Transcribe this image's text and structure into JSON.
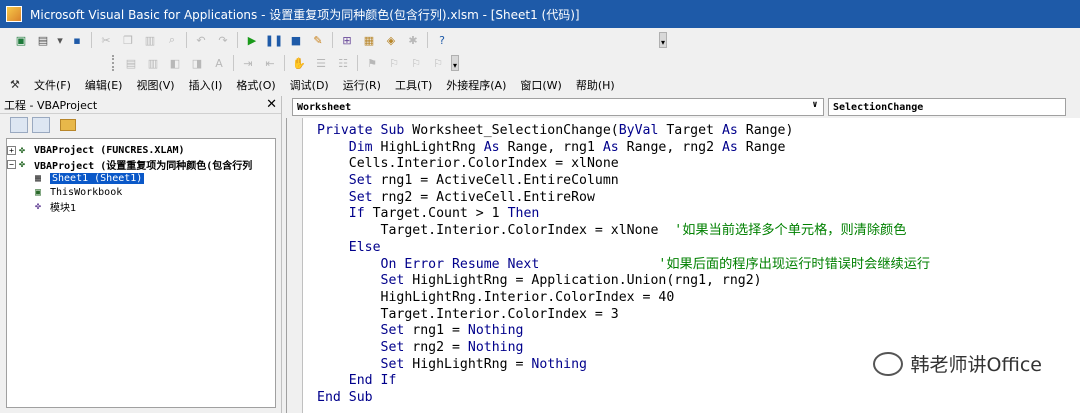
{
  "window": {
    "title": "Microsoft Visual Basic for Applications - 设置重复项为同种颜色(包含行列).xlsm - [Sheet1 (代码)]"
  },
  "toolbar1": {
    "icons": [
      "excel-icon",
      "insert-icon",
      "dropdown-icon",
      "save-icon",
      "cut-icon",
      "copy-icon",
      "paste-icon",
      "find-icon",
      "undo-icon",
      "redo-icon",
      "run-icon",
      "break-icon",
      "reset-icon",
      "design-mode-icon",
      "project-explorer-icon",
      "properties-icon",
      "object-browser-icon",
      "toolbox-icon",
      "help-icon"
    ]
  },
  "menu": {
    "items": [
      "文件(F)",
      "编辑(E)",
      "视图(V)",
      "插入(I)",
      "格式(O)",
      "调试(D)",
      "运行(R)",
      "工具(T)",
      "外接程序(A)",
      "窗口(W)",
      "帮助(H)"
    ]
  },
  "project": {
    "header": "工程 - VBAProject",
    "close_glyph": "✕",
    "tree": [
      {
        "expander": "+",
        "label": "VBAProject (FUNCRES.XLAM)"
      },
      {
        "expander": "−",
        "label": "VBAProject (设置重复项为同种颜色(包含行列"
      },
      {
        "label": "Sheet1 (Sheet1)"
      },
      {
        "label": "ThisWorkbook"
      },
      {
        "label": "模块1"
      }
    ]
  },
  "code": {
    "object_combo": "Worksheet",
    "procedure_combo": "SelectionChange",
    "lines": [
      [
        {
          "t": "Private Sub ",
          "c": "kw"
        },
        {
          "t": "Worksheet_SelectionChange(",
          "c": "tx"
        },
        {
          "t": "ByVal",
          "c": "kw"
        },
        {
          "t": " Target ",
          "c": "tx"
        },
        {
          "t": "As",
          "c": "kw"
        },
        {
          "t": " Range)",
          "c": "tx"
        }
      ],
      [
        {
          "t": "    Dim",
          "c": "kw"
        },
        {
          "t": " HighLightRng ",
          "c": "tx"
        },
        {
          "t": "As",
          "c": "kw"
        },
        {
          "t": " Range, rng1 ",
          "c": "tx"
        },
        {
          "t": "As",
          "c": "kw"
        },
        {
          "t": " Range, rng2 ",
          "c": "tx"
        },
        {
          "t": "As",
          "c": "kw"
        },
        {
          "t": " Range",
          "c": "tx"
        }
      ],
      [
        {
          "t": "    Cells.Interior.ColorIndex = xlNone",
          "c": "tx"
        }
      ],
      [
        {
          "t": "    Set",
          "c": "kw"
        },
        {
          "t": " rng1 = ActiveCell.EntireColumn",
          "c": "tx"
        }
      ],
      [
        {
          "t": "    Set",
          "c": "kw"
        },
        {
          "t": " rng2 = ActiveCell.EntireRow",
          "c": "tx"
        }
      ],
      [
        {
          "t": "    If",
          "c": "kw"
        },
        {
          "t": " Target.Count > 1 ",
          "c": "tx"
        },
        {
          "t": "Then",
          "c": "kw"
        }
      ],
      [
        {
          "t": "        Target.Interior.ColorIndex = xlNone  ",
          "c": "tx"
        },
        {
          "t": "'如果当前选择多个单元格，则清除颜色",
          "c": "cm"
        }
      ],
      [
        {
          "t": "    Else",
          "c": "kw"
        }
      ],
      [
        {
          "t": "        On Error Resume Next",
          "c": "kw"
        },
        {
          "t": "               ",
          "c": "tx"
        },
        {
          "t": "'如果后面的程序出现运行时错误时会继续运行",
          "c": "cm"
        }
      ],
      [
        {
          "t": "        Set",
          "c": "kw"
        },
        {
          "t": " HighLightRng = Application.Union(rng1, rng2)",
          "c": "tx"
        }
      ],
      [
        {
          "t": "        HighLightRng.Interior.ColorIndex = 40",
          "c": "tx"
        }
      ],
      [
        {
          "t": "        Target.Interior.ColorIndex = 3",
          "c": "tx"
        }
      ],
      [
        {
          "t": "        Set",
          "c": "kw"
        },
        {
          "t": " rng1 = ",
          "c": "tx"
        },
        {
          "t": "Nothing",
          "c": "kw"
        }
      ],
      [
        {
          "t": "        Set",
          "c": "kw"
        },
        {
          "t": " rng2 = ",
          "c": "tx"
        },
        {
          "t": "Nothing",
          "c": "kw"
        }
      ],
      [
        {
          "t": "        Set",
          "c": "kw"
        },
        {
          "t": " HighLightRng = ",
          "c": "tx"
        },
        {
          "t": "Nothing",
          "c": "kw"
        }
      ],
      [
        {
          "t": "    End If",
          "c": "kw"
        }
      ],
      [
        {
          "t": "End Sub",
          "c": "kw"
        }
      ]
    ]
  },
  "watermark": {
    "text": "韩老师讲Office"
  },
  "colors": {
    "keyword": "#00008b",
    "comment": "#008000",
    "title_bar": "#1e5aa8",
    "selection": "#0a58c8"
  }
}
